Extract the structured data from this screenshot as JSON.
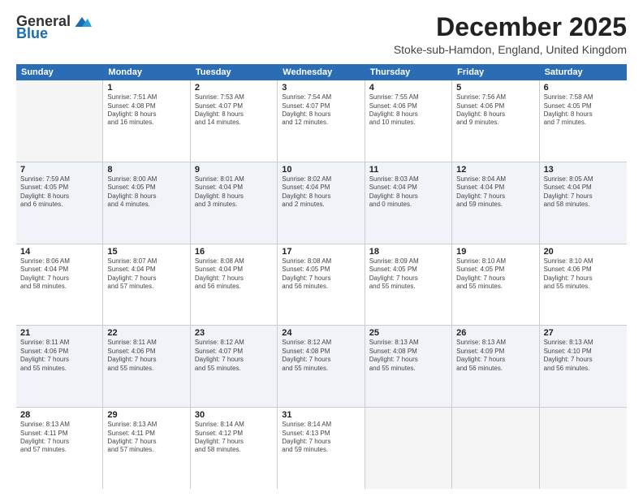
{
  "logo": {
    "general": "General",
    "blue": "Blue"
  },
  "title": "December 2025",
  "subtitle": "Stoke-sub-Hamdon, England, United Kingdom",
  "headers": [
    "Sunday",
    "Monday",
    "Tuesday",
    "Wednesday",
    "Thursday",
    "Friday",
    "Saturday"
  ],
  "rows": [
    [
      {
        "num": "",
        "lines": []
      },
      {
        "num": "1",
        "lines": [
          "Sunrise: 7:51 AM",
          "Sunset: 4:08 PM",
          "Daylight: 8 hours",
          "and 16 minutes."
        ]
      },
      {
        "num": "2",
        "lines": [
          "Sunrise: 7:53 AM",
          "Sunset: 4:07 PM",
          "Daylight: 8 hours",
          "and 14 minutes."
        ]
      },
      {
        "num": "3",
        "lines": [
          "Sunrise: 7:54 AM",
          "Sunset: 4:07 PM",
          "Daylight: 8 hours",
          "and 12 minutes."
        ]
      },
      {
        "num": "4",
        "lines": [
          "Sunrise: 7:55 AM",
          "Sunset: 4:06 PM",
          "Daylight: 8 hours",
          "and 10 minutes."
        ]
      },
      {
        "num": "5",
        "lines": [
          "Sunrise: 7:56 AM",
          "Sunset: 4:06 PM",
          "Daylight: 8 hours",
          "and 9 minutes."
        ]
      },
      {
        "num": "6",
        "lines": [
          "Sunrise: 7:58 AM",
          "Sunset: 4:05 PM",
          "Daylight: 8 hours",
          "and 7 minutes."
        ]
      }
    ],
    [
      {
        "num": "7",
        "lines": [
          "Sunrise: 7:59 AM",
          "Sunset: 4:05 PM",
          "Daylight: 8 hours",
          "and 6 minutes."
        ]
      },
      {
        "num": "8",
        "lines": [
          "Sunrise: 8:00 AM",
          "Sunset: 4:05 PM",
          "Daylight: 8 hours",
          "and 4 minutes."
        ]
      },
      {
        "num": "9",
        "lines": [
          "Sunrise: 8:01 AM",
          "Sunset: 4:04 PM",
          "Daylight: 8 hours",
          "and 3 minutes."
        ]
      },
      {
        "num": "10",
        "lines": [
          "Sunrise: 8:02 AM",
          "Sunset: 4:04 PM",
          "Daylight: 8 hours",
          "and 2 minutes."
        ]
      },
      {
        "num": "11",
        "lines": [
          "Sunrise: 8:03 AM",
          "Sunset: 4:04 PM",
          "Daylight: 8 hours",
          "and 0 minutes."
        ]
      },
      {
        "num": "12",
        "lines": [
          "Sunrise: 8:04 AM",
          "Sunset: 4:04 PM",
          "Daylight: 7 hours",
          "and 59 minutes."
        ]
      },
      {
        "num": "13",
        "lines": [
          "Sunrise: 8:05 AM",
          "Sunset: 4:04 PM",
          "Daylight: 7 hours",
          "and 58 minutes."
        ]
      }
    ],
    [
      {
        "num": "14",
        "lines": [
          "Sunrise: 8:06 AM",
          "Sunset: 4:04 PM",
          "Daylight: 7 hours",
          "and 58 minutes."
        ]
      },
      {
        "num": "15",
        "lines": [
          "Sunrise: 8:07 AM",
          "Sunset: 4:04 PM",
          "Daylight: 7 hours",
          "and 57 minutes."
        ]
      },
      {
        "num": "16",
        "lines": [
          "Sunrise: 8:08 AM",
          "Sunset: 4:04 PM",
          "Daylight: 7 hours",
          "and 56 minutes."
        ]
      },
      {
        "num": "17",
        "lines": [
          "Sunrise: 8:08 AM",
          "Sunset: 4:05 PM",
          "Daylight: 7 hours",
          "and 56 minutes."
        ]
      },
      {
        "num": "18",
        "lines": [
          "Sunrise: 8:09 AM",
          "Sunset: 4:05 PM",
          "Daylight: 7 hours",
          "and 55 minutes."
        ]
      },
      {
        "num": "19",
        "lines": [
          "Sunrise: 8:10 AM",
          "Sunset: 4:05 PM",
          "Daylight: 7 hours",
          "and 55 minutes."
        ]
      },
      {
        "num": "20",
        "lines": [
          "Sunrise: 8:10 AM",
          "Sunset: 4:06 PM",
          "Daylight: 7 hours",
          "and 55 minutes."
        ]
      }
    ],
    [
      {
        "num": "21",
        "lines": [
          "Sunrise: 8:11 AM",
          "Sunset: 4:06 PM",
          "Daylight: 7 hours",
          "and 55 minutes."
        ]
      },
      {
        "num": "22",
        "lines": [
          "Sunrise: 8:11 AM",
          "Sunset: 4:06 PM",
          "Daylight: 7 hours",
          "and 55 minutes."
        ]
      },
      {
        "num": "23",
        "lines": [
          "Sunrise: 8:12 AM",
          "Sunset: 4:07 PM",
          "Daylight: 7 hours",
          "and 55 minutes."
        ]
      },
      {
        "num": "24",
        "lines": [
          "Sunrise: 8:12 AM",
          "Sunset: 4:08 PM",
          "Daylight: 7 hours",
          "and 55 minutes."
        ]
      },
      {
        "num": "25",
        "lines": [
          "Sunrise: 8:13 AM",
          "Sunset: 4:08 PM",
          "Daylight: 7 hours",
          "and 55 minutes."
        ]
      },
      {
        "num": "26",
        "lines": [
          "Sunrise: 8:13 AM",
          "Sunset: 4:09 PM",
          "Daylight: 7 hours",
          "and 56 minutes."
        ]
      },
      {
        "num": "27",
        "lines": [
          "Sunrise: 8:13 AM",
          "Sunset: 4:10 PM",
          "Daylight: 7 hours",
          "and 56 minutes."
        ]
      }
    ],
    [
      {
        "num": "28",
        "lines": [
          "Sunrise: 8:13 AM",
          "Sunset: 4:11 PM",
          "Daylight: 7 hours",
          "and 57 minutes."
        ]
      },
      {
        "num": "29",
        "lines": [
          "Sunrise: 8:13 AM",
          "Sunset: 4:11 PM",
          "Daylight: 7 hours",
          "and 57 minutes."
        ]
      },
      {
        "num": "30",
        "lines": [
          "Sunrise: 8:14 AM",
          "Sunset: 4:12 PM",
          "Daylight: 7 hours",
          "and 58 minutes."
        ]
      },
      {
        "num": "31",
        "lines": [
          "Sunrise: 8:14 AM",
          "Sunset: 4:13 PM",
          "Daylight: 7 hours",
          "and 59 minutes."
        ]
      },
      {
        "num": "",
        "lines": []
      },
      {
        "num": "",
        "lines": []
      },
      {
        "num": "",
        "lines": []
      }
    ]
  ]
}
